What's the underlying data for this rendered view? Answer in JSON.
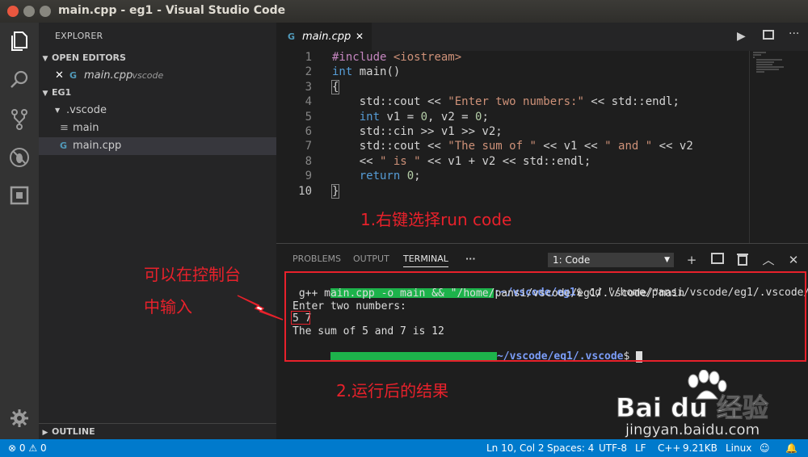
{
  "window": {
    "title": "main.cpp - eg1 - Visual Studio Code"
  },
  "sidebar": {
    "header": "EXPLORER",
    "open_editors": {
      "label": "OPEN EDITORS",
      "items": [
        {
          "name": "main.cpp",
          "path": ".vscode"
        }
      ]
    },
    "folder": {
      "label": "EG1",
      "items": [
        ".vscode",
        "main",
        "main.cpp"
      ]
    },
    "outline": "OUTLINE"
  },
  "editor": {
    "tab_label": "main.cpp",
    "line_numbers": [
      "1",
      "2",
      "3",
      "4",
      "5",
      "6",
      "7",
      "8",
      "9",
      "10"
    ],
    "code": {
      "l1_pre": "#include",
      "l1_inc": "<iostream>",
      "l2_kw": "int",
      "l2_rest": " main()",
      "l3": "{",
      "l4_a": "    std::cout << ",
      "l4_str": "\"Enter two numbers:\"",
      "l4_b": " << std::endl;",
      "l5_kw": "    int",
      "l5_a": " v1 = ",
      "l5_n1": "0",
      "l5_b": ", v2 = ",
      "l5_n2": "0",
      "l5_c": ";",
      "l6": "    std::cin >> v1 >> v2;",
      "l7_a": "    std::cout << ",
      "l7_s1": "\"The sum of \"",
      "l7_b": " << v1 << ",
      "l7_s2": "\" and \"",
      "l7_c": " << v2",
      "l8_a": "    << ",
      "l8_s": "\" is \"",
      "l8_b": " << v1 + v2 << std::endl;",
      "l9_kw": "    return",
      "l9_n": " 0",
      "l9_c": ";",
      "l10": "}"
    }
  },
  "panel": {
    "tabs": [
      "PROBLEMS",
      "OUTPUT",
      "TERMINAL"
    ],
    "more": "···",
    "terminal_select": "1: Code",
    "terminal": {
      "line1_path": ":~/vscode/eg1",
      "line1_cmd": "$ cd \"/home/pansi/vscode/eg1/.vscode/\" &&",
      "line2": " g++ main.cpp -o main && \"/home/pansi/vscode/eg1/.vscode/\"main",
      "line3": "Enter two numbers:",
      "line4": "5 7",
      "line5": "The sum of 5 and 7 is 12",
      "line6_path": "~/vscode/eg1/.vscode",
      "line6_prompt": "$"
    }
  },
  "annotations": {
    "right_click": "1.右键选择run code",
    "input_hint_1": "可以在控制台",
    "input_hint_2": "中输入",
    "result": "2.运行后的结果",
    "watermark_logo": "Bai du 经验",
    "watermark_url": "jingyan.baidu.com"
  },
  "status": {
    "errors": "0",
    "warnings": "0",
    "position": "Ln 10, Col 2",
    "spaces": "Spaces: 4",
    "encoding": "UTF-8",
    "eol": "LF",
    "language": "C++",
    "size": "9.21KB",
    "os": "Linux"
  },
  "colors": {
    "accent": "#007acc",
    "annotation": "#e8212b",
    "prompt_green": "#59d15b",
    "prompt_blue": "#7b9df8"
  }
}
